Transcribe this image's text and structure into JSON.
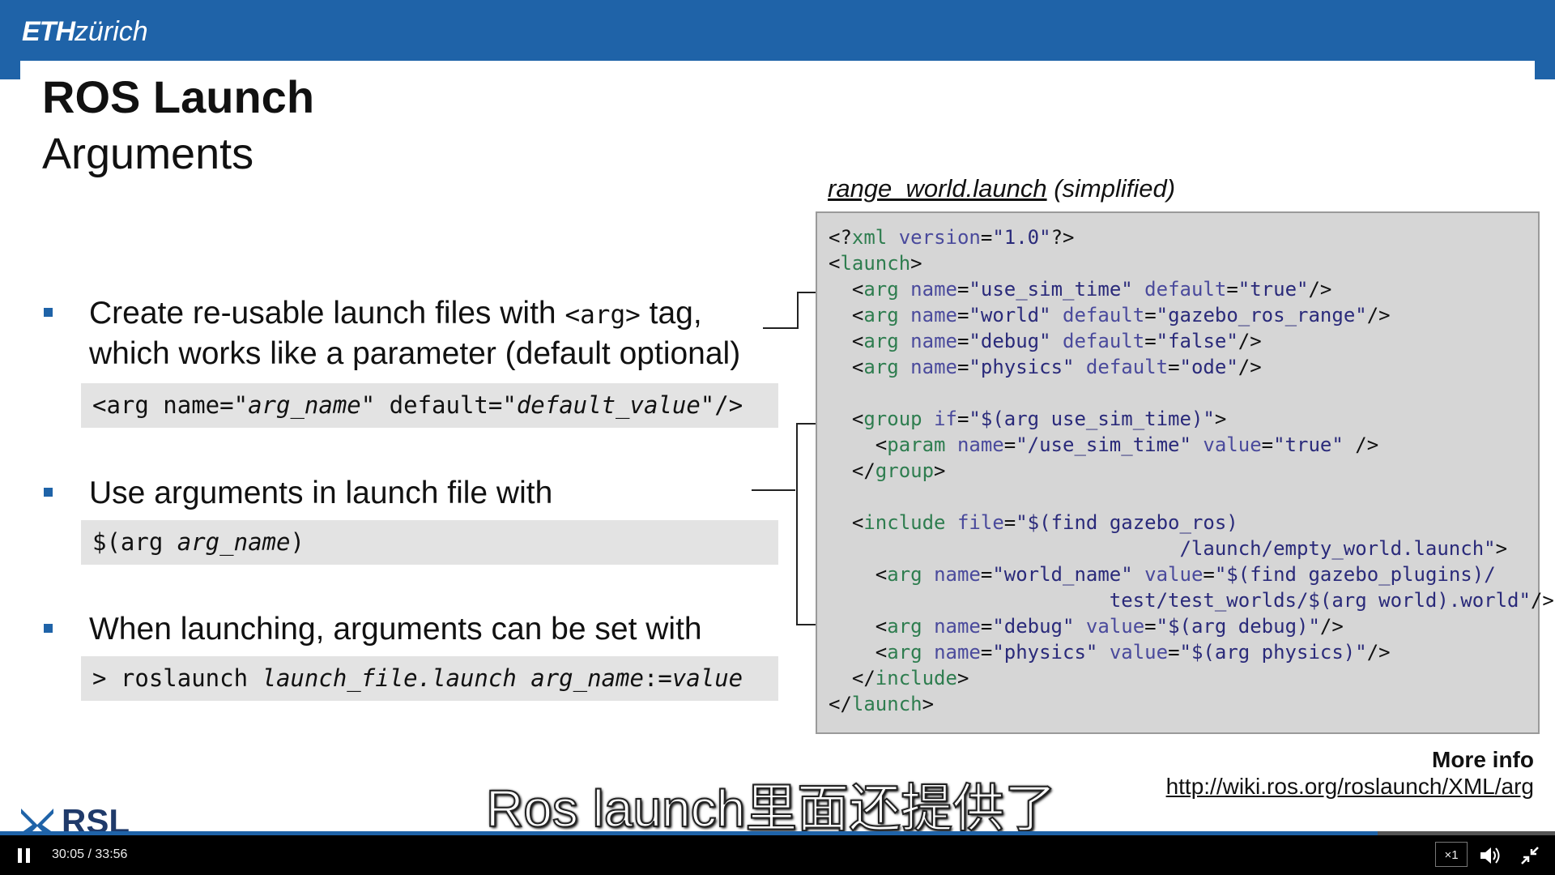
{
  "header": {
    "logo_bold": "ETH",
    "logo_light": "zürich"
  },
  "slide": {
    "title": "ROS Launch",
    "subtitle": "Arguments",
    "bullets": [
      {
        "line1_a": "Create re-usable launch files with ",
        "line1_code": "<arg>",
        "line1_b": " tag,",
        "line2": "which works like a parameter (default optional)"
      },
      {
        "line1": "Use arguments in launch file with"
      },
      {
        "line1": "When launching, arguments can be set with"
      }
    ],
    "code_examples": [
      {
        "p1": "<arg name=\"",
        "i1": "arg_name",
        "p2": "\" default=\"",
        "i2": "default_value",
        "p3": "\"/>"
      },
      {
        "p1": "$(arg ",
        "i1": "arg_name",
        "p2": ")"
      },
      {
        "p1": "> roslaunch ",
        "i1": "launch_file.launch arg_name",
        "p2": ":=",
        "i2": "value"
      }
    ],
    "file_caption_name": "range_world.launch",
    "file_caption_note": " (simplified)",
    "more_info_label": "More info",
    "more_info_link": "http://wiki.ros.org/roslaunch/XML/arg"
  },
  "code_lines": [
    [
      [
        "p",
        "<?"
      ],
      [
        "t",
        "xml"
      ],
      [
        "p",
        " "
      ],
      [
        "a",
        "version"
      ],
      [
        "p",
        "="
      ],
      [
        "s",
        "\"1.0\""
      ],
      [
        "p",
        "?>"
      ]
    ],
    [
      [
        "p",
        "<"
      ],
      [
        "t",
        "launch"
      ],
      [
        "p",
        ">"
      ]
    ],
    [
      [
        "p",
        "  <"
      ],
      [
        "t",
        "arg"
      ],
      [
        "p",
        " "
      ],
      [
        "a",
        "name"
      ],
      [
        "p",
        "="
      ],
      [
        "s",
        "\"use_sim_time\""
      ],
      [
        "p",
        " "
      ],
      [
        "a",
        "default"
      ],
      [
        "p",
        "="
      ],
      [
        "s",
        "\"true\""
      ],
      [
        "p",
        "/>"
      ]
    ],
    [
      [
        "p",
        "  <"
      ],
      [
        "t",
        "arg"
      ],
      [
        "p",
        " "
      ],
      [
        "a",
        "name"
      ],
      [
        "p",
        "="
      ],
      [
        "s",
        "\"world\""
      ],
      [
        "p",
        " "
      ],
      [
        "a",
        "default"
      ],
      [
        "p",
        "="
      ],
      [
        "s",
        "\"gazebo_ros_range\""
      ],
      [
        "p",
        "/>"
      ]
    ],
    [
      [
        "p",
        "  <"
      ],
      [
        "t",
        "arg"
      ],
      [
        "p",
        " "
      ],
      [
        "a",
        "name"
      ],
      [
        "p",
        "="
      ],
      [
        "s",
        "\"debug\""
      ],
      [
        "p",
        " "
      ],
      [
        "a",
        "default"
      ],
      [
        "p",
        "="
      ],
      [
        "s",
        "\"false\""
      ],
      [
        "p",
        "/>"
      ]
    ],
    [
      [
        "p",
        "  <"
      ],
      [
        "t",
        "arg"
      ],
      [
        "p",
        " "
      ],
      [
        "a",
        "name"
      ],
      [
        "p",
        "="
      ],
      [
        "s",
        "\"physics\""
      ],
      [
        "p",
        " "
      ],
      [
        "a",
        "default"
      ],
      [
        "p",
        "="
      ],
      [
        "s",
        "\"ode\""
      ],
      [
        "p",
        "/>"
      ]
    ],
    [],
    [
      [
        "p",
        "  <"
      ],
      [
        "t",
        "group"
      ],
      [
        "p",
        " "
      ],
      [
        "a",
        "if"
      ],
      [
        "p",
        "="
      ],
      [
        "s",
        "\"$(arg use_sim_time)\""
      ],
      [
        "p",
        ">"
      ]
    ],
    [
      [
        "p",
        "    <"
      ],
      [
        "t",
        "param"
      ],
      [
        "p",
        " "
      ],
      [
        "a",
        "name"
      ],
      [
        "p",
        "="
      ],
      [
        "s",
        "\"/use_sim_time\""
      ],
      [
        "p",
        " "
      ],
      [
        "a",
        "value"
      ],
      [
        "p",
        "="
      ],
      [
        "s",
        "\"true\""
      ],
      [
        "p",
        " />"
      ]
    ],
    [
      [
        "p",
        "  </"
      ],
      [
        "t",
        "group"
      ],
      [
        "p",
        ">"
      ]
    ],
    [],
    [
      [
        "p",
        "  <"
      ],
      [
        "t",
        "include"
      ],
      [
        "p",
        " "
      ],
      [
        "a",
        "file"
      ],
      [
        "p",
        "="
      ],
      [
        "s",
        "\"$(find gazebo_ros)"
      ]
    ],
    [
      [
        "s",
        "                              /launch/empty_world.launch\""
      ],
      [
        "p",
        ">"
      ]
    ],
    [
      [
        "p",
        "    <"
      ],
      [
        "t",
        "arg"
      ],
      [
        "p",
        " "
      ],
      [
        "a",
        "name"
      ],
      [
        "p",
        "="
      ],
      [
        "s",
        "\"world_name\""
      ],
      [
        "p",
        " "
      ],
      [
        "a",
        "value"
      ],
      [
        "p",
        "="
      ],
      [
        "s",
        "\"$(find gazebo_plugins)/"
      ]
    ],
    [
      [
        "s",
        "                        test/test_worlds/$(arg world).world\""
      ],
      [
        "p",
        "/>"
      ]
    ],
    [
      [
        "p",
        "    <"
      ],
      [
        "t",
        "arg"
      ],
      [
        "p",
        " "
      ],
      [
        "a",
        "name"
      ],
      [
        "p",
        "="
      ],
      [
        "s",
        "\"debug\""
      ],
      [
        "p",
        " "
      ],
      [
        "a",
        "value"
      ],
      [
        "p",
        "="
      ],
      [
        "s",
        "\"$(arg debug)\""
      ],
      [
        "p",
        "/>"
      ]
    ],
    [
      [
        "p",
        "    <"
      ],
      [
        "t",
        "arg"
      ],
      [
        "p",
        " "
      ],
      [
        "a",
        "name"
      ],
      [
        "p",
        "="
      ],
      [
        "s",
        "\"physics\""
      ],
      [
        "p",
        " "
      ],
      [
        "a",
        "value"
      ],
      [
        "p",
        "="
      ],
      [
        "s",
        "\"$(arg physics)\""
      ],
      [
        "p",
        "/>"
      ]
    ],
    [
      [
        "p",
        "  </"
      ],
      [
        "t",
        "include"
      ],
      [
        "p",
        ">"
      ]
    ],
    [
      [
        "p",
        "</"
      ],
      [
        "t",
        "launch"
      ],
      [
        "p",
        ">"
      ]
    ]
  ],
  "caption": "Ros launch里面还提供了",
  "player": {
    "time_current": "30:05",
    "time_total": "33:56",
    "progress": 0.886,
    "speed": "×1",
    "icons": [
      "pause-icon",
      "volume-icon",
      "fullscreen-exit-icon"
    ]
  },
  "colors": {
    "eth_blue": "#1f63a8",
    "code_bg": "#d6d6d6",
    "tag": "#2e7d4f",
    "attr": "#4a4a9c"
  }
}
